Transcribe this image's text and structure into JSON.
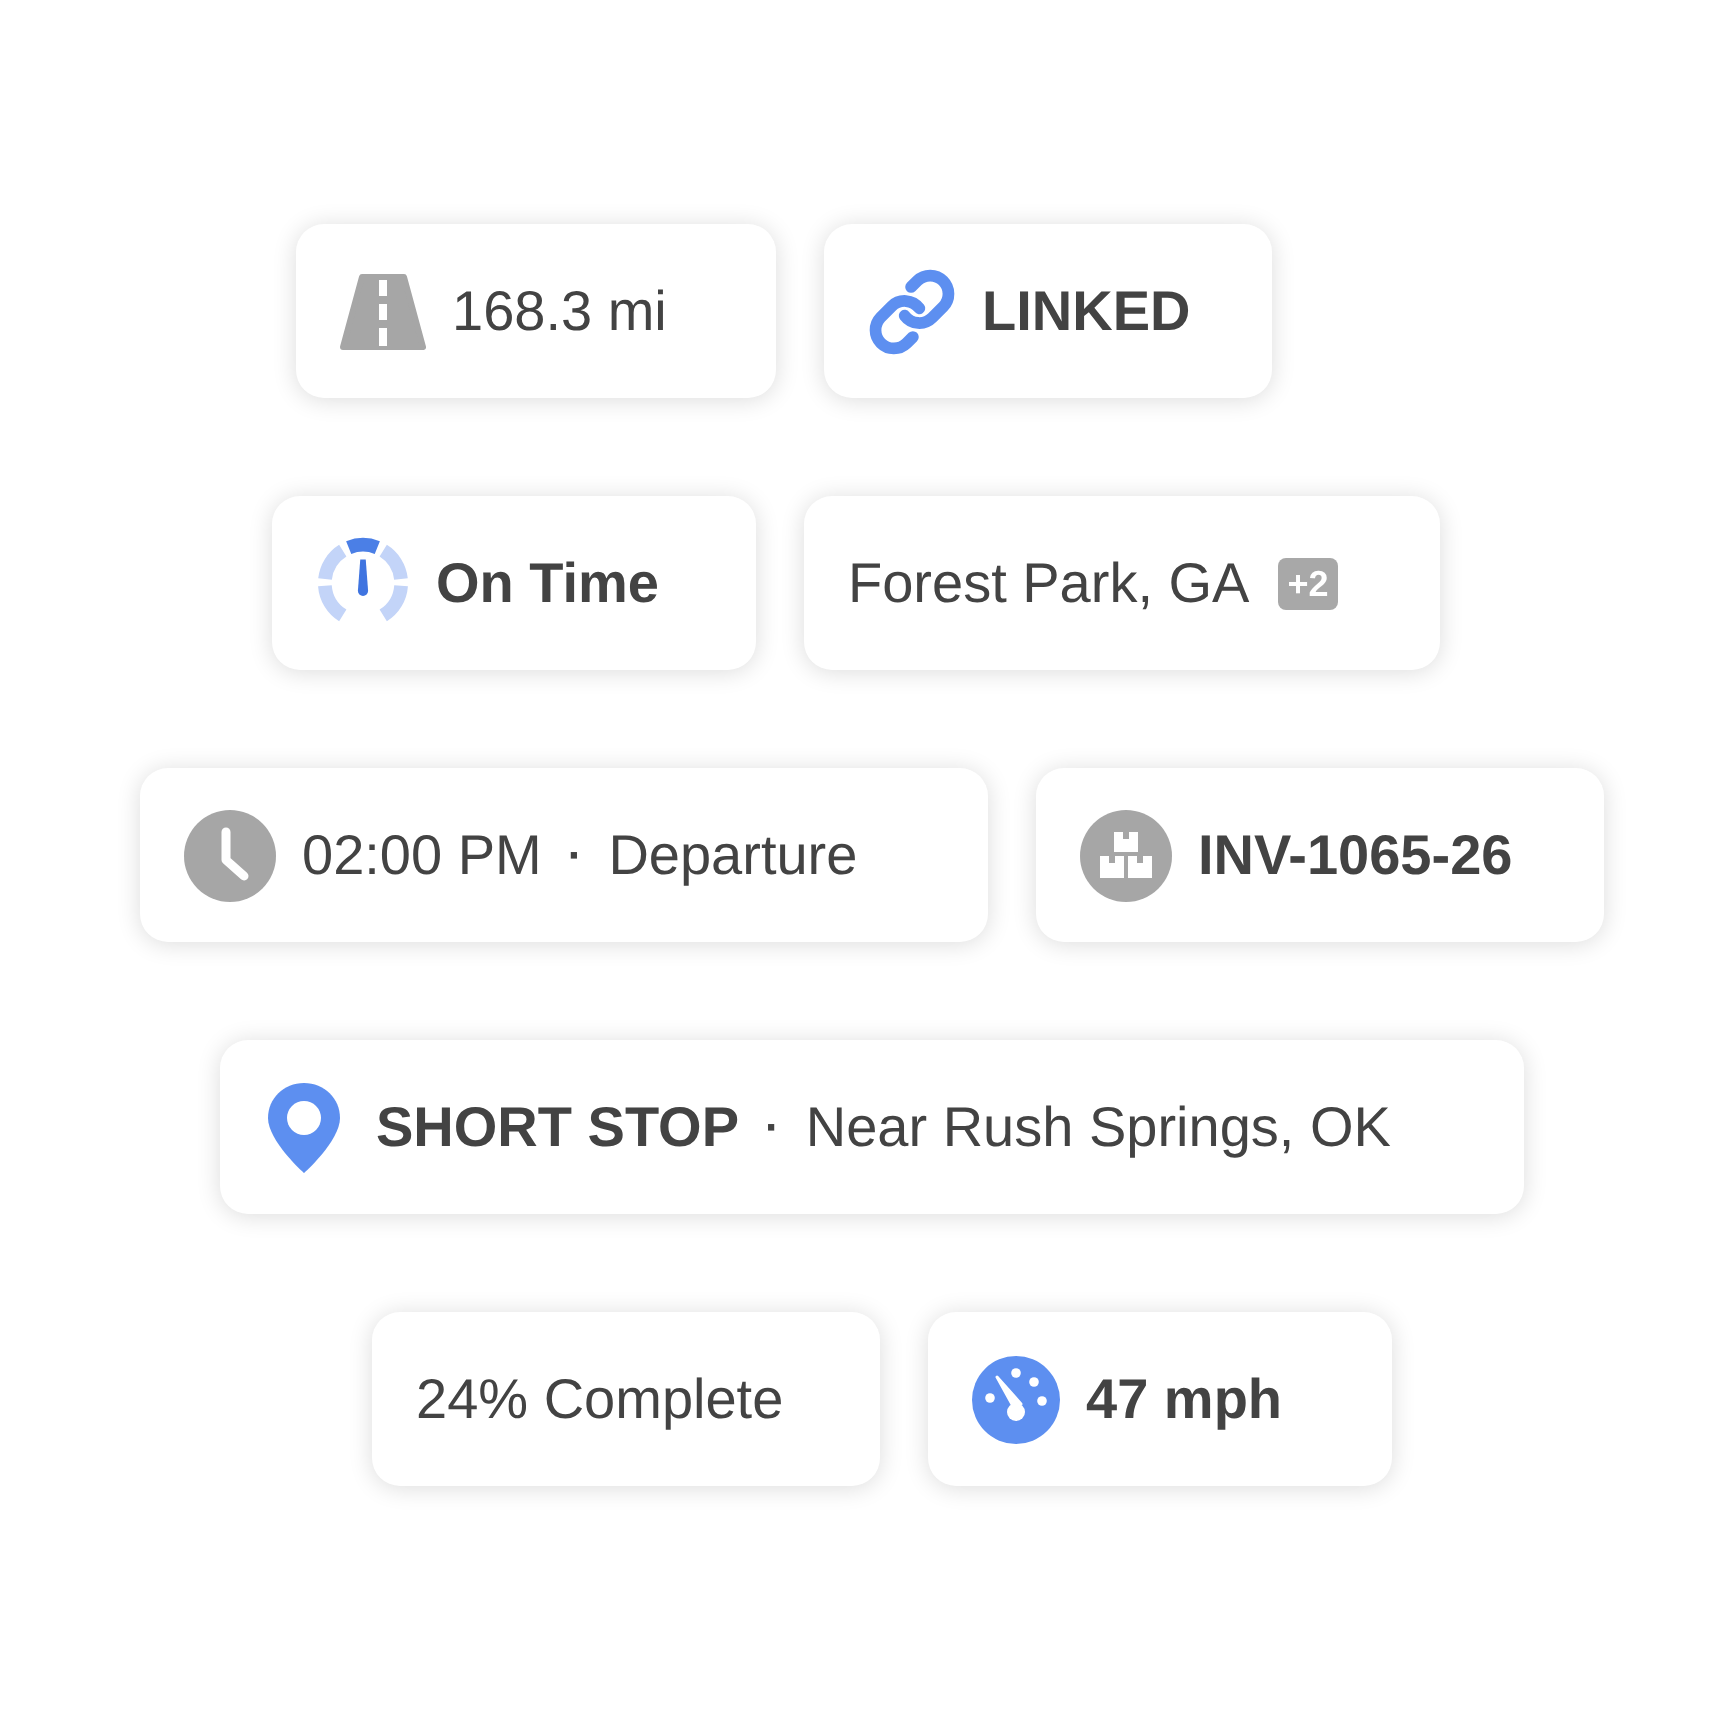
{
  "rows": [
    {
      "chips": [
        {
          "kind": "distance",
          "text": "168.3 mi"
        },
        {
          "kind": "link",
          "text": "LINKED"
        }
      ]
    },
    {
      "chips": [
        {
          "kind": "eta",
          "text": "On Time"
        },
        {
          "kind": "location",
          "text": "Forest Park, GA",
          "badge": "+2"
        }
      ]
    },
    {
      "chips": [
        {
          "kind": "departure",
          "time": "02:00 PM",
          "separator": "·",
          "event": "Departure"
        },
        {
          "kind": "invoice",
          "text": "INV-1065-26"
        }
      ]
    },
    {
      "chips": [
        {
          "kind": "stop",
          "label": "SHORT STOP",
          "separator": "·",
          "detail": "Near Rush Springs, OK"
        }
      ]
    },
    {
      "chips": [
        {
          "kind": "progress",
          "text": "24% Complete"
        },
        {
          "kind": "speed",
          "text": "47 mph"
        }
      ]
    }
  ]
}
